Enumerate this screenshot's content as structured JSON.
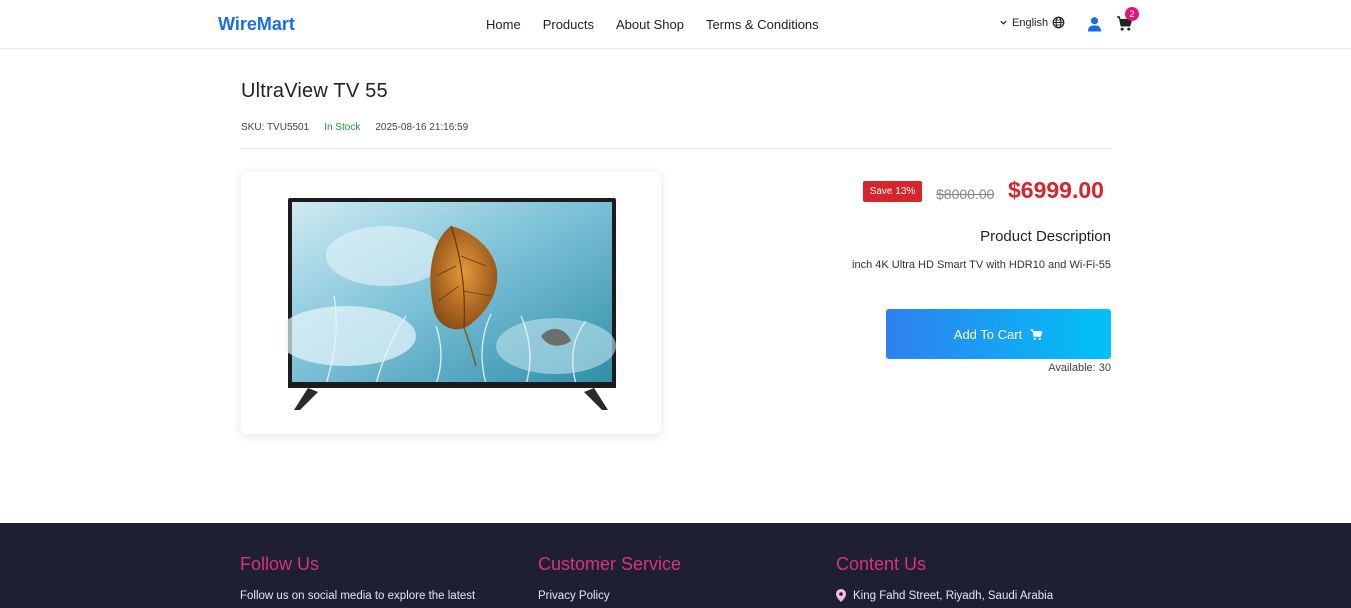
{
  "header": {
    "logo": "WireMart",
    "nav": [
      "Home",
      "Products",
      "About Shop",
      "Terms & Conditions"
    ],
    "language": "English",
    "cart_count": "2",
    "icons": [
      "chevron-down-icon",
      "globe-icon",
      "user-icon",
      "cart-icon"
    ]
  },
  "product": {
    "title": "UltraView TV 55",
    "sku": "SKU: TVU5501",
    "stock": "In Stock",
    "timestamp": "2025-08-16 21:16:59",
    "save_badge": "Save 13%",
    "old_price": "$8000.00",
    "new_price": "$6999.00",
    "description_title": "Product Description",
    "description": "inch 4K Ultra HD Smart TV with HDR10 and Wi-Fi-55",
    "add_to_cart": "Add To Cart",
    "available": "Available: 30"
  },
  "footer": {
    "follow_title": "Follow Us",
    "follow_text": "Follow us on social media to explore the latest",
    "service_title": "Customer Service",
    "service_link": "Privacy Policy",
    "contact_title": "Content Us",
    "address": "King Fahd Street, Riyadh, Saudi Arabia"
  },
  "colors": {
    "brand": "#1a6fe0",
    "price": "#d7262b",
    "stock": "#1a9a3a",
    "badge": "#e4157a",
    "footer_bg": "#1e1f33",
    "footer_heading": "#d9327f"
  }
}
